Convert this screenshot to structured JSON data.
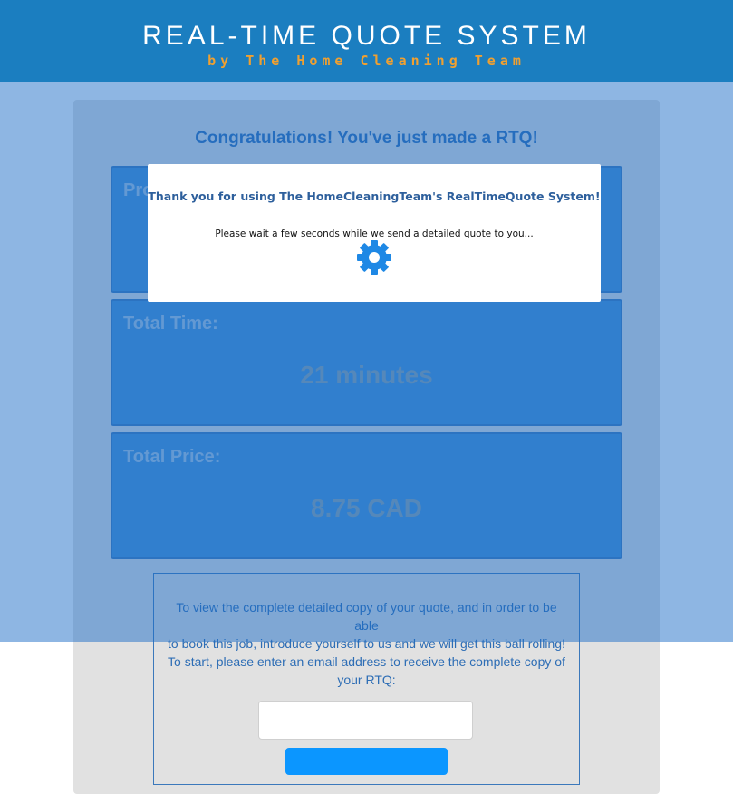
{
  "header": {
    "title": "REAL-TIME QUOTE SYSTEM",
    "subtitle": "by The Home Cleaning Team"
  },
  "main": {
    "congrats": "Congratulations! You've just made a RTQ!",
    "panels": [
      {
        "label": "Pro",
        "value": ""
      },
      {
        "label": "Total Time:",
        "value": "21 minutes"
      },
      {
        "label": "Total Price:",
        "value": "8.75 CAD"
      }
    ],
    "email": {
      "lines": [
        "To view the complete detailed copy of your quote, and in order to be able",
        "to book this job, introduce yourself to us and we will get this ball rolling!",
        "To start, please enter an email address to receive the complete copy of your RTQ:"
      ],
      "input_value": "",
      "input_placeholder": "",
      "button_label": ""
    }
  },
  "modal": {
    "title": "Thank you for using The HomeCleaningTeam's RealTimeQuote System!",
    "message": "Please wait a few seconds while we send a detailed quote to you...",
    "icon": "gear-icon"
  },
  "colors": {
    "header_bg": "#1b7ec0",
    "subtitle": "#f0a030",
    "panel_bg": "#4590d4",
    "accent_text": "#2d6db5",
    "button": "#0b96ff",
    "spinner": "#1e88e5"
  }
}
